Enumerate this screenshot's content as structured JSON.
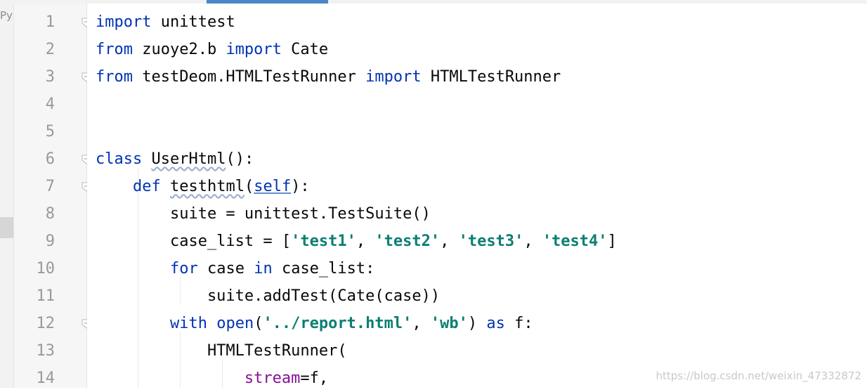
{
  "tabs": {
    "left_label": "Py"
  },
  "editor": {
    "line_numbers": [
      "1",
      "2",
      "3",
      "4",
      "5",
      "6",
      "7",
      "8",
      "9",
      "10",
      "11",
      "12",
      "13",
      "14"
    ],
    "lines": [
      [
        {
          "t": "import",
          "c": "kw"
        },
        {
          "t": " unittest",
          "c": ""
        }
      ],
      [
        {
          "t": "from",
          "c": "kw"
        },
        {
          "t": " zuoye2.b ",
          "c": ""
        },
        {
          "t": "import",
          "c": "kw"
        },
        {
          "t": " Cate",
          "c": ""
        }
      ],
      [
        {
          "t": "from",
          "c": "kw"
        },
        {
          "t": " testDeom.HTMLTestRunner ",
          "c": ""
        },
        {
          "t": "import",
          "c": "kw"
        },
        {
          "t": " HTMLTestRunner",
          "c": ""
        }
      ],
      [],
      [],
      [
        {
          "t": "class",
          "c": "kw"
        },
        {
          "t": " ",
          "c": ""
        },
        {
          "t": "UserHtml",
          "c": "squiggle"
        },
        {
          "t": "():",
          "c": ""
        }
      ],
      [
        {
          "t": "    ",
          "c": ""
        },
        {
          "t": "def",
          "c": "kw"
        },
        {
          "t": " ",
          "c": ""
        },
        {
          "t": "testhtml",
          "c": "squiggle"
        },
        {
          "t": "(",
          "c": ""
        },
        {
          "t": "self",
          "c": "self-kw"
        },
        {
          "t": "):",
          "c": ""
        }
      ],
      [
        {
          "t": "        suite = unittest.TestSuite()",
          "c": ""
        }
      ],
      [
        {
          "t": "        case_list = [",
          "c": ""
        },
        {
          "t": "'test1'",
          "c": "str-teal"
        },
        {
          "t": ", ",
          "c": ""
        },
        {
          "t": "'test2'",
          "c": "str-teal"
        },
        {
          "t": ", ",
          "c": ""
        },
        {
          "t": "'test3'",
          "c": "str-teal"
        },
        {
          "t": ", ",
          "c": ""
        },
        {
          "t": "'test4'",
          "c": "str-teal"
        },
        {
          "t": "]",
          "c": ""
        }
      ],
      [
        {
          "t": "        ",
          "c": ""
        },
        {
          "t": "for",
          "c": "kw"
        },
        {
          "t": " case ",
          "c": ""
        },
        {
          "t": "in",
          "c": "kw"
        },
        {
          "t": " case_list:",
          "c": ""
        }
      ],
      [
        {
          "t": "            suite.addTest(Cate(case))",
          "c": ""
        }
      ],
      [
        {
          "t": "        ",
          "c": ""
        },
        {
          "t": "with",
          "c": "kw"
        },
        {
          "t": " ",
          "c": ""
        },
        {
          "t": "open",
          "c": "kw"
        },
        {
          "t": "(",
          "c": ""
        },
        {
          "t": "'../report.html'",
          "c": "str-teal"
        },
        {
          "t": ", ",
          "c": ""
        },
        {
          "t": "'wb'",
          "c": "str-teal"
        },
        {
          "t": ") ",
          "c": ""
        },
        {
          "t": "as",
          "c": "kw"
        },
        {
          "t": " f:",
          "c": ""
        }
      ],
      [
        {
          "t": "            HTMLTestRunner(",
          "c": ""
        }
      ],
      [
        {
          "t": "                ",
          "c": ""
        },
        {
          "t": "stream",
          "c": "param"
        },
        {
          "t": "=f,",
          "c": ""
        }
      ]
    ],
    "fold_lines": [
      1,
      3,
      6,
      7,
      12
    ]
  },
  "watermark": "https://blog.csdn.net/weixin_47332872"
}
